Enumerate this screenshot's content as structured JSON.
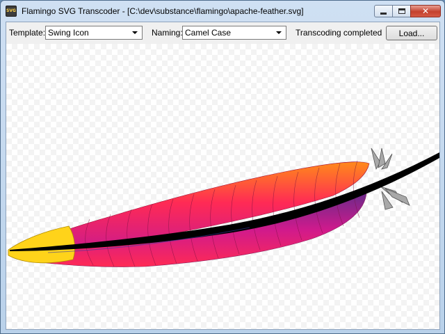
{
  "window": {
    "title": "Flamingo SVG Transcoder - [C:\\dev\\substance\\flamingo\\apache-feather.svg]",
    "app_icon_text": "SVG",
    "controls": {
      "minimize": "minimize",
      "maximize": "maximize",
      "close": "✕"
    }
  },
  "toolbar": {
    "template_label": "Template:",
    "template_value": "Swing Icon",
    "naming_label": "Naming:",
    "naming_value": "Camel Case",
    "status": "Transcoding completed",
    "load_label": "Load..."
  },
  "canvas": {
    "image": "apache-feather",
    "colors": {
      "tip": "#ffd31a",
      "orange": "#ff7a1a",
      "red": "#ff2255",
      "magenta": "#d01a8c",
      "purple": "#6a2a8a",
      "quill": "#000000",
      "fluff": "#9a9a9a"
    }
  }
}
